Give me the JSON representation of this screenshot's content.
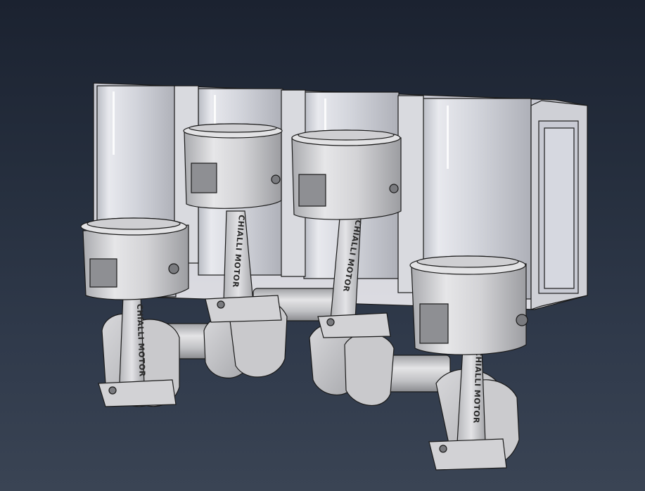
{
  "scene": {
    "subject": "four-cylinder-piston-crankshaft-assembly",
    "background_top": "#1b2230",
    "background_bottom": "#3a4454",
    "metal_light": "#e9eaec",
    "metal_mid": "#c4c5c8",
    "metal_dark": "#8f9094",
    "edge_color": "#1a1a1a"
  },
  "rods": [
    {
      "engraving": "CHIALLI MOTOR"
    },
    {
      "engraving": "CHIALLI MOTOR"
    },
    {
      "engraving": "CHIALLI MOTOR"
    },
    {
      "engraving": "CHIALLI MOTOR"
    }
  ]
}
